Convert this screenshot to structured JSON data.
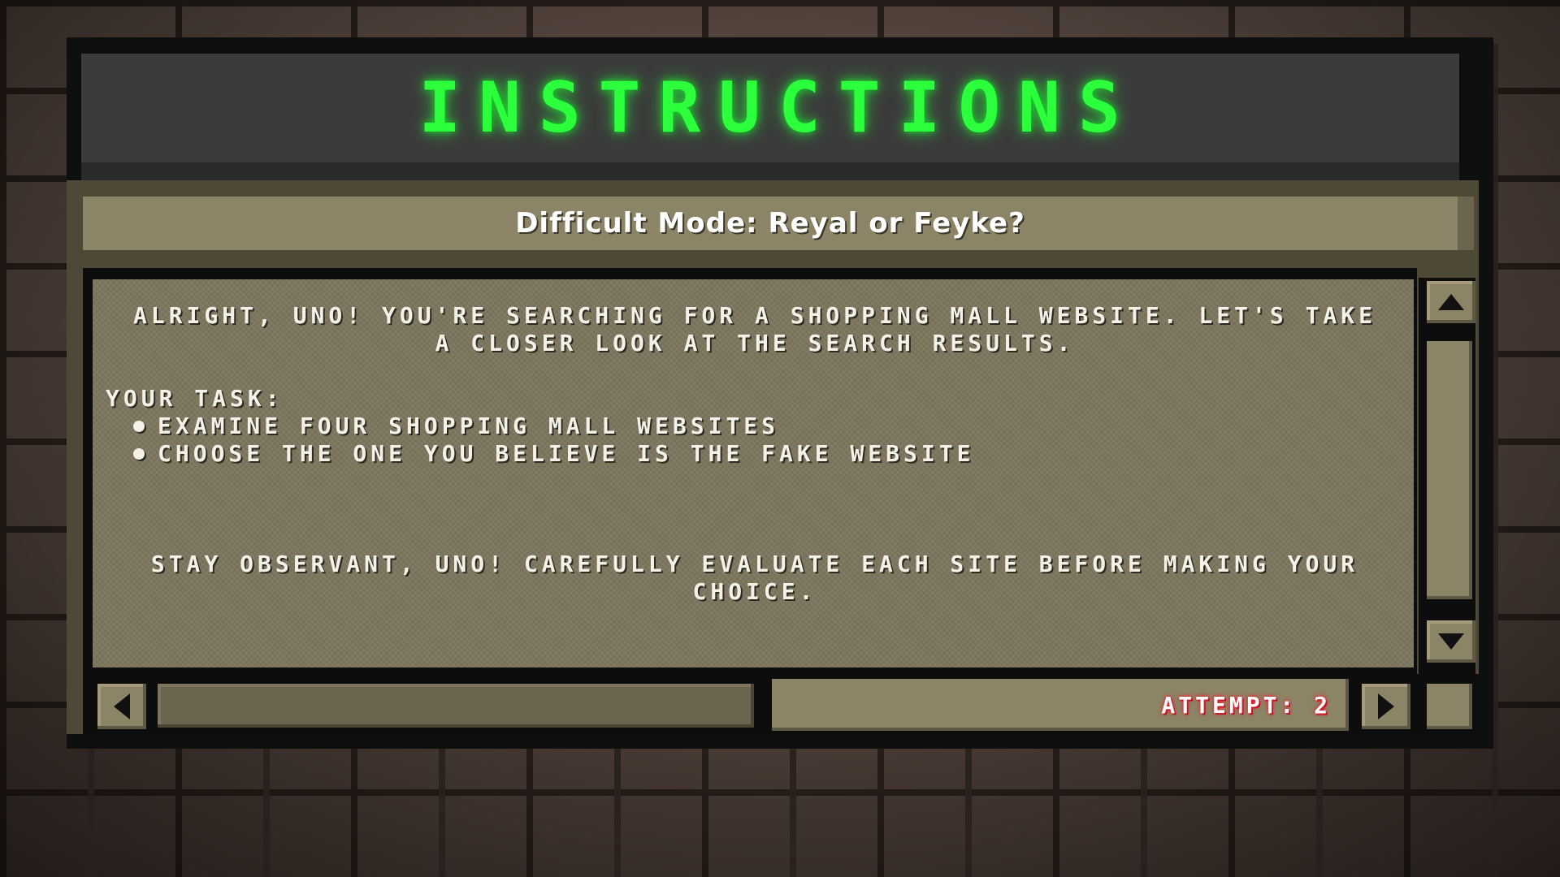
{
  "title": "INSTRUCTIONS",
  "subtitle": "Difficult Mode: Reyal or Feyke?",
  "content": {
    "intro": "ALRIGHT, UNO! YOU'RE SEARCHING FOR A SHOPPING MALL WEBSITE. LET'S TAKE A CLOSER LOOK AT THE SEARCH RESULTS.",
    "task_heading": "YOUR TASK:",
    "tasks": [
      "EXAMINE FOUR SHOPPING MALL WEBSITES",
      "CHOOSE THE ONE YOU BELIEVE IS THE FAKE WEBSITE"
    ],
    "outro": "STAY OBSERVANT, UNO! CAREFULLY EVALUATE EACH SITE BEFORE MAKING YOUR CHOICE."
  },
  "status": {
    "attempt": "ATTEMPT: 2"
  },
  "icons": {
    "scroll_up": "triangle-up-icon",
    "scroll_down": "triangle-down-icon",
    "scroll_left": "triangle-left-icon",
    "scroll_right": "triangle-right-icon"
  },
  "colors": {
    "title_green": "#2cff3c",
    "attempt_red": "#e0202a",
    "panel_khaki": "#8c8467"
  }
}
